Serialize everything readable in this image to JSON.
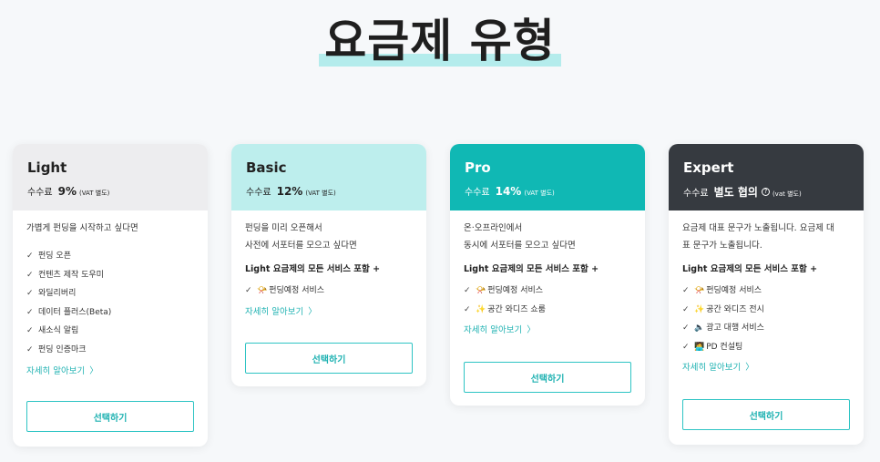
{
  "page": {
    "title": "요금제 유형"
  },
  "colors": {
    "light_header": "#ededef",
    "basic_header": "#bdeeed",
    "pro_header": "#10b8b4",
    "expert_header": "#363a40",
    "accent": "#1fb2b2"
  },
  "icons": {
    "check": "check-icon",
    "chevron": "chevron-right-icon"
  },
  "plans": [
    {
      "name": "Light",
      "fee_label": "수수료",
      "fee_value": "9%",
      "vat": "(VAT 별도)",
      "description": [
        "가볍게 펀딩을 시작하고 싶다면"
      ],
      "features": [
        "펀딩 오픈",
        "컨텐츠 제작 도우미",
        "와딜리버리",
        "데이터 플러스(Beta)",
        "새소식 알림",
        "펀딩 인증마크"
      ],
      "more": "자세히 알아보기",
      "select": "선택하기"
    },
    {
      "name": "Basic",
      "fee_label": "수수료",
      "fee_value": "12%",
      "vat": "(VAT 별도)",
      "description": [
        "펀딩을 미리 오픈해서",
        "사전에 서포터를 모으고 싶다면"
      ],
      "included": "Light 요금제의 모든 서비스 포함 +",
      "features": [
        {
          "emoji": "📯",
          "text": "펀딩예정 서비스"
        }
      ],
      "more": "자세히 알아보기",
      "select": "선택하기"
    },
    {
      "name": "Pro",
      "fee_label": "수수료",
      "fee_value": "14%",
      "vat": "(VAT 별도)",
      "description": [
        "온·오프라인에서",
        "동시에 서포터를 모으고 싶다면"
      ],
      "included": "Light 요금제의 모든 서비스 포함 +",
      "features": [
        {
          "emoji": "📯",
          "text": "펀딩예정 서비스"
        },
        {
          "emoji": "✨",
          "text": "공간 와디즈 쇼룸"
        }
      ],
      "more": "자세히 알아보기",
      "select": "선택하기"
    },
    {
      "name": "Expert",
      "fee_label": "수수료",
      "fee_value": "별도 협의",
      "vat": "(vat 별도)",
      "description": [
        "요금제 대표 문구가 노출됩니다. 요금제 대",
        "표 문구가 노출됩니다."
      ],
      "included": "Light 요금제의 모든 서비스 포함 +",
      "features": [
        {
          "emoji": "📯",
          "text": "펀딩예정 서비스"
        },
        {
          "emoji": "✨",
          "text": "공간 와디즈 전시"
        },
        {
          "emoji": "🔈",
          "text": "광고 대행 서비스"
        },
        {
          "emoji": "🧑‍💻",
          "text": "PD 컨설팅"
        }
      ],
      "more": "자세히 알아보기",
      "select": "선택하기"
    }
  ]
}
